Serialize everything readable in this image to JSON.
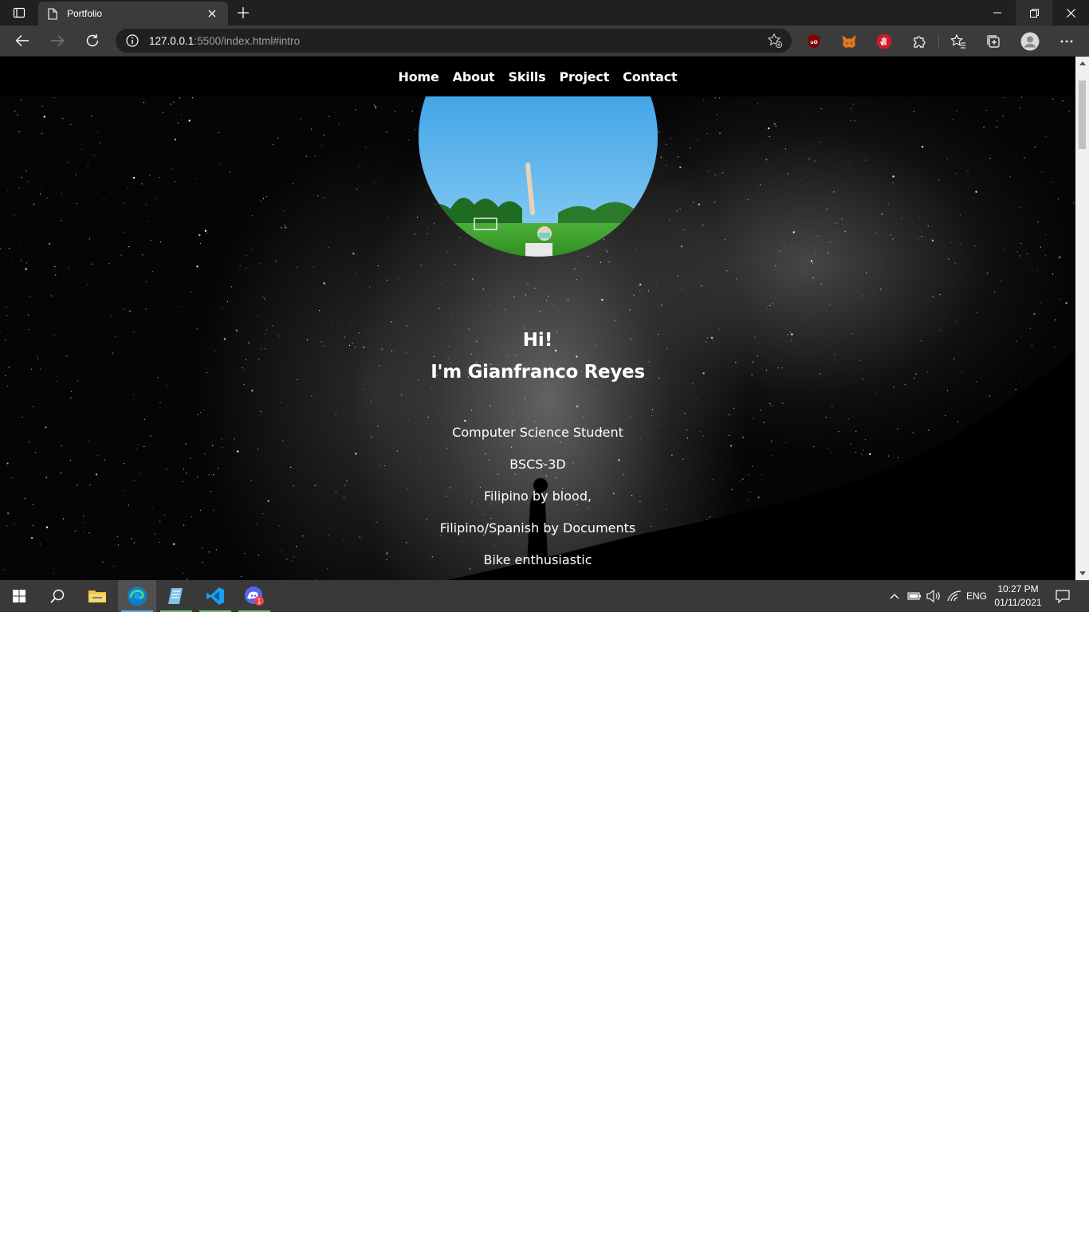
{
  "browser": {
    "tab_title": "Portfolio",
    "url_host": "127.0.0.1",
    "url_rest": ":5500/index.html#intro"
  },
  "site": {
    "nav": [
      "Home",
      "About",
      "Skills",
      "Project",
      "Contact"
    ],
    "greeting": "Hi!",
    "name": "I'm Gianfranco Reyes",
    "lines": [
      "Computer Science Student",
      "BSCS-3D",
      "Filipino by blood,",
      "Filipino/Spanish by Documents",
      "Bike enthusiastic"
    ]
  },
  "taskbar": {
    "language": "ENG",
    "time": "10:27 PM",
    "date": "01/11/2021",
    "discord_badge": "1"
  },
  "colors": {
    "titlebar": "#202020",
    "toolbar": "#3b3b3b",
    "taskbar": "#393939",
    "accent": "#5fb2f0"
  },
  "icons": [
    "tab-actions-icon",
    "page-icon",
    "close-icon",
    "plus-icon",
    "minimize-icon",
    "restore-icon",
    "back-icon",
    "forward-icon",
    "refresh-icon",
    "info-icon",
    "favorite-add-icon",
    "ublock-icon",
    "metamask-icon",
    "stop-hand-icon",
    "extensions-icon",
    "favorites-icon",
    "collections-icon",
    "profile-icon",
    "more-icon",
    "windows-start-icon",
    "search-icon",
    "file-explorer-icon",
    "edge-icon",
    "notepad-icon",
    "vscode-icon",
    "discord-icon",
    "chevron-up-icon",
    "battery-icon",
    "volume-icon",
    "wifi-icon",
    "notification-icon"
  ]
}
